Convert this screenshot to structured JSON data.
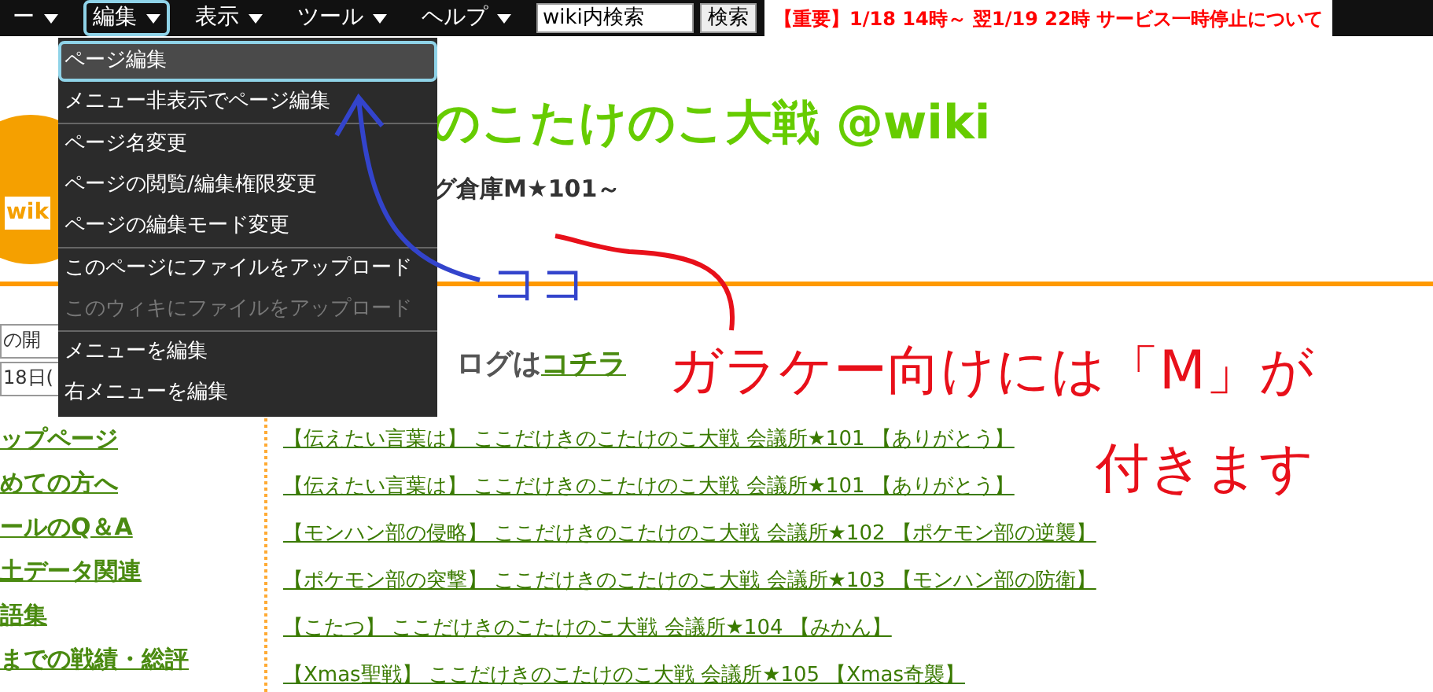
{
  "menubar": {
    "items": [
      {
        "label": "ー",
        "selected": false
      },
      {
        "label": "編集",
        "selected": true
      },
      {
        "label": "表示",
        "selected": false
      },
      {
        "label": "ツール",
        "selected": false
      },
      {
        "label": "ヘルプ",
        "selected": false
      }
    ],
    "search": {
      "value": "wiki内検索",
      "button": "検索"
    },
    "notice": "【重要】1/18 14時～ 翌1/19 22時 サービス一時停止について"
  },
  "dropdown": {
    "groups": [
      [
        {
          "label": "ページ編集",
          "selected": true,
          "disabled": false
        },
        {
          "label": "メニュー非表示でページ編集",
          "selected": false,
          "disabled": false
        }
      ],
      [
        {
          "label": "ページ名変更",
          "selected": false,
          "disabled": false
        },
        {
          "label": "ページの閲覧/編集権限変更",
          "selected": false,
          "disabled": false
        },
        {
          "label": "ページの編集モード変更",
          "selected": false,
          "disabled": false
        }
      ],
      [
        {
          "label": "このページにファイルをアップロード",
          "selected": false,
          "disabled": false
        },
        {
          "label": "このウィキにファイルをアップロード",
          "selected": false,
          "disabled": true
        }
      ],
      [
        {
          "label": "メニューを編集",
          "selected": false,
          "disabled": false
        },
        {
          "label": "右メニューを編集",
          "selected": false,
          "disabled": false
        }
      ]
    ]
  },
  "header": {
    "logo_text": "wik",
    "title": "のこたけのこ大戦 @wiki",
    "subtitle": "グ倉庫M★101～"
  },
  "sidebar": {
    "fields": [
      "の開",
      "18日("
    ],
    "links": [
      "ップページ",
      "めての方へ",
      "ールのQ＆A",
      "土データ関連",
      "語集",
      "までの戦績・総評"
    ]
  },
  "main": {
    "intro": "ログは",
    "intro_link": "コチラ",
    "links": [
      "【伝えたい言葉は】 ここだけきのこたけのこ大戦 会議所★101 【ありがとう】",
      "【伝えたい言葉は】 ここだけきのこたけのこ大戦 会議所★101 【ありがとう】",
      "【モンハン部の侵略】 ここだけきのこたけのこ大戦 会議所★102 【ポケモン部の逆襲】",
      "【ポケモン部の突撃】 ここだけきのこたけのこ大戦 会議所★103 【モンハン部の防衛】",
      "【こたつ】 ここだけきのこたけのこ大戦 会議所★104 【みかん】",
      "【Xmas聖戦】 ここだけきのこたけのこ大戦 会議所★105 【Xmas奇襲】"
    ]
  },
  "annotations": [
    {
      "kind": "here",
      "lines": [
        "ココ"
      ],
      "color": "#3344cc"
    },
    {
      "kind": "note",
      "lines": [
        "ガラケー向けには「M」が",
        "付きます"
      ],
      "color": "#e8101a"
    }
  ]
}
